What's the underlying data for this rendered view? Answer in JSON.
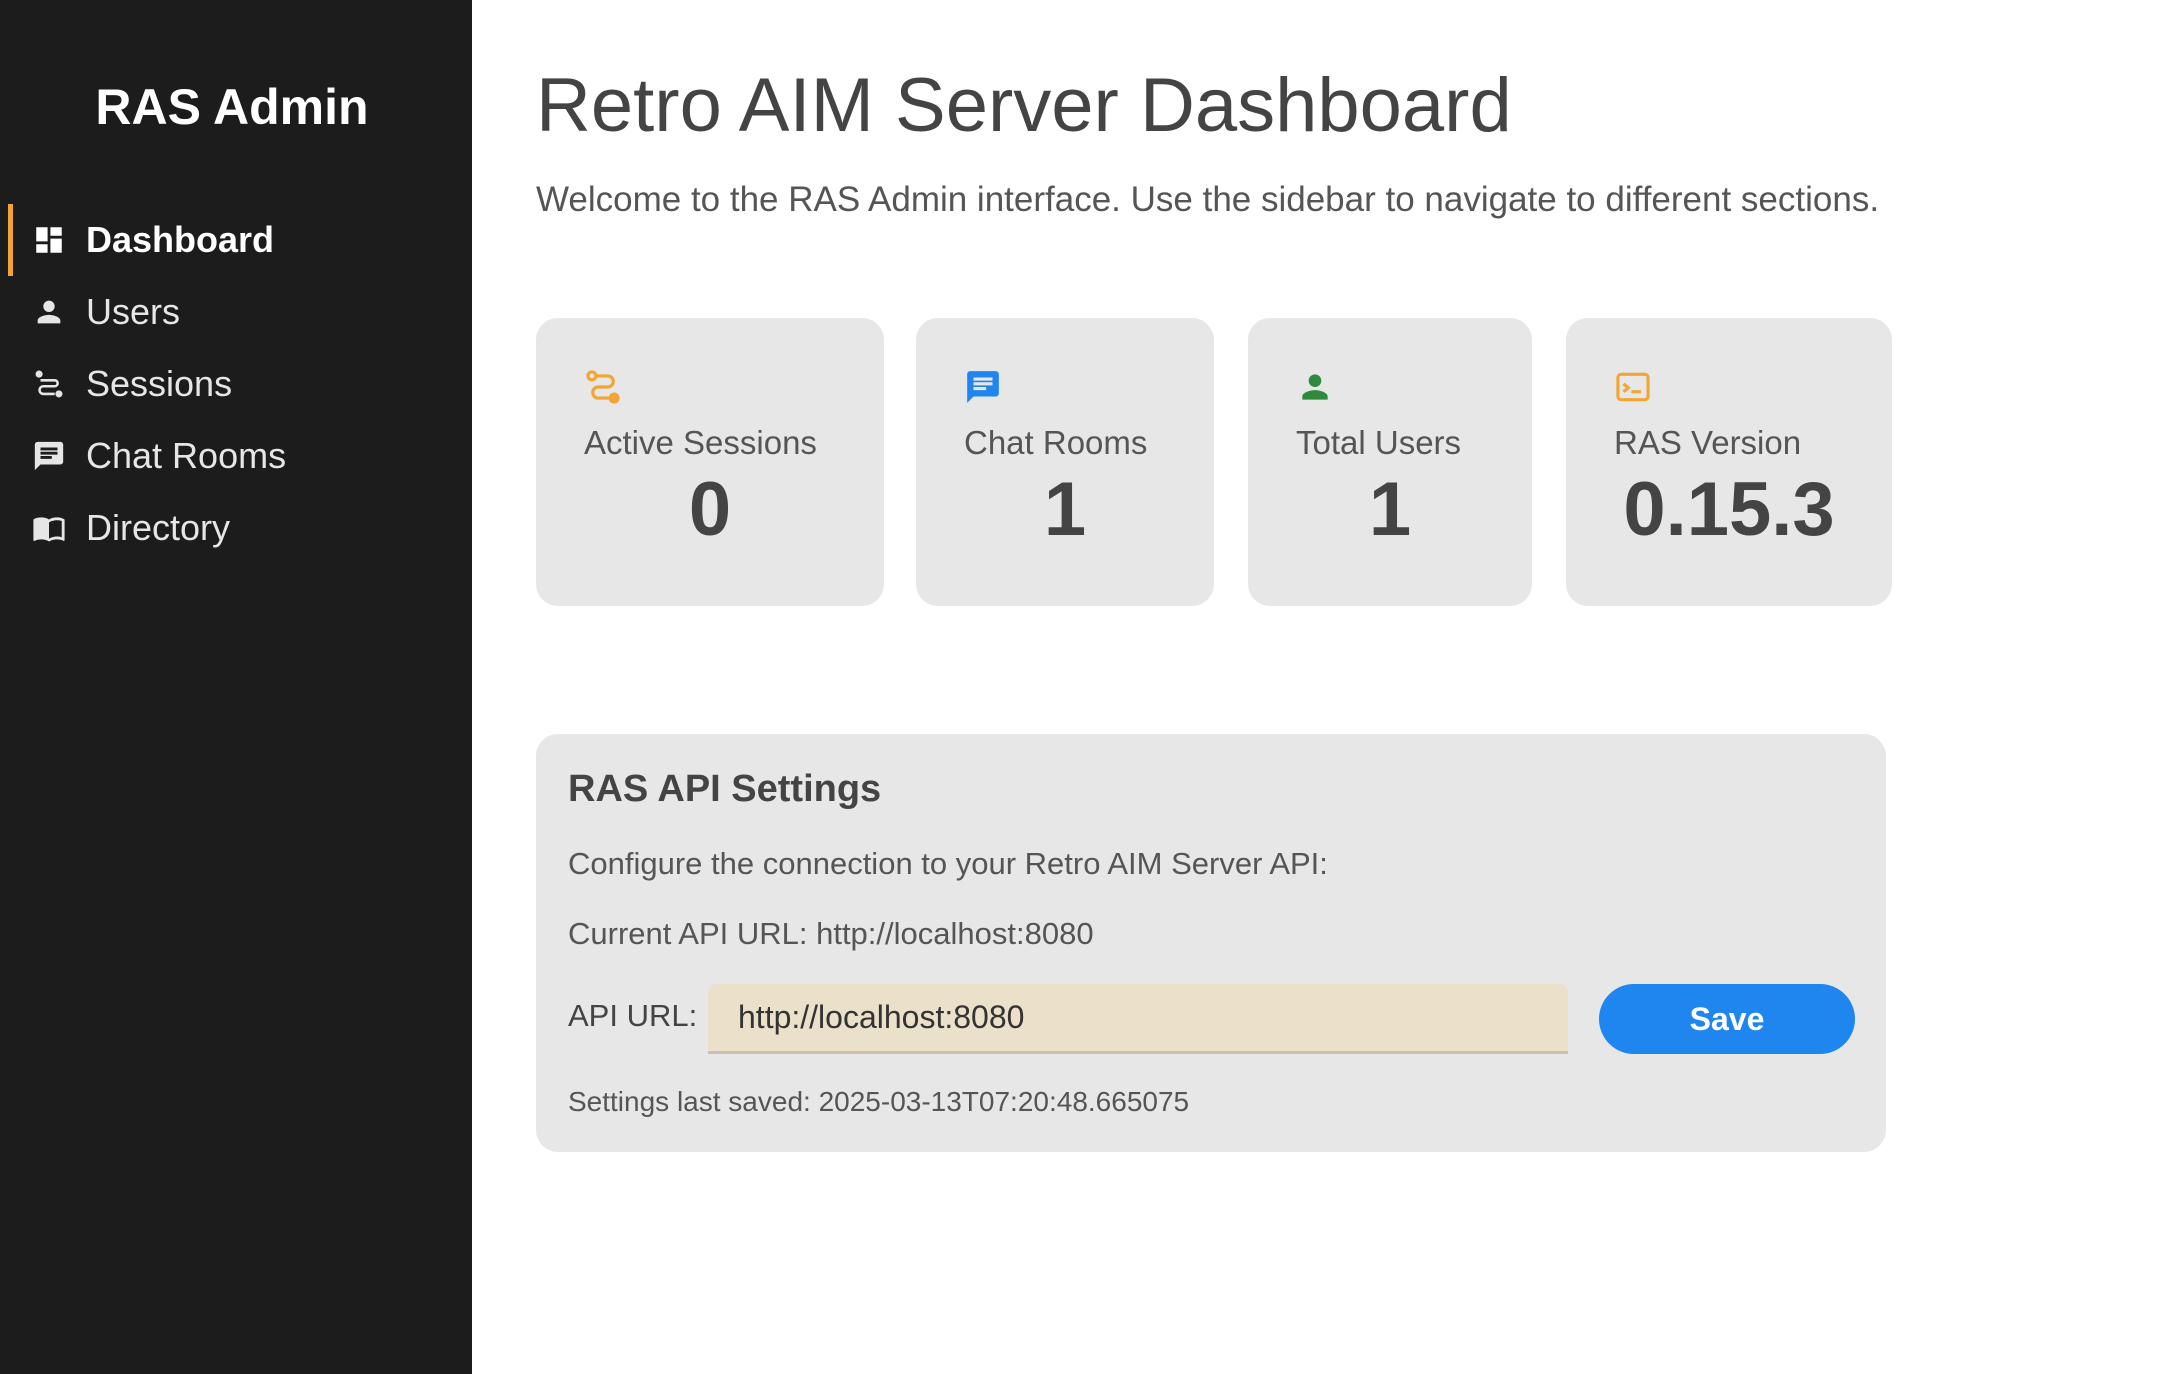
{
  "sidebar": {
    "brand": "RAS Admin",
    "items": [
      {
        "label": "Dashboard",
        "icon": "dashboard-icon",
        "active": true
      },
      {
        "label": "Users",
        "icon": "person-icon",
        "active": false
      },
      {
        "label": "Sessions",
        "icon": "route-icon",
        "active": false
      },
      {
        "label": "Chat Rooms",
        "icon": "chat-icon",
        "active": false
      },
      {
        "label": "Directory",
        "icon": "book-icon",
        "active": false
      }
    ]
  },
  "main": {
    "title": "Retro AIM Server Dashboard",
    "welcome": "Welcome to the RAS Admin interface. Use the sidebar to navigate to different sections.",
    "cards": [
      {
        "label": "Active Sessions",
        "value": "0",
        "icon": "route-icon",
        "color": "#f2a534"
      },
      {
        "label": "Chat Rooms",
        "value": "1",
        "icon": "chat-icon",
        "color": "#1f86f0"
      },
      {
        "label": "Total Users",
        "value": "1",
        "icon": "person-icon",
        "color": "#2e8b3e"
      },
      {
        "label": "RAS Version",
        "value": "0.15.3",
        "icon": "terminal-icon",
        "color": "#f2a534"
      }
    ]
  },
  "settings": {
    "title": "RAS API Settings",
    "description": "Configure the connection to your Retro AIM Server API:",
    "current_url": "Current API URL: http://localhost:8080",
    "api_label": "API URL:",
    "api_value": "http://localhost:8080",
    "save_label": "Save",
    "last_saved": "Settings last saved: 2025-03-13T07:20:48.665075"
  },
  "colors": {
    "sidebar_bg": "#1c1c1c",
    "accent": "#f2a534",
    "primary": "#1f86f0",
    "card_bg": "#e7e7e7",
    "input_bg": "#ebe0c9"
  }
}
